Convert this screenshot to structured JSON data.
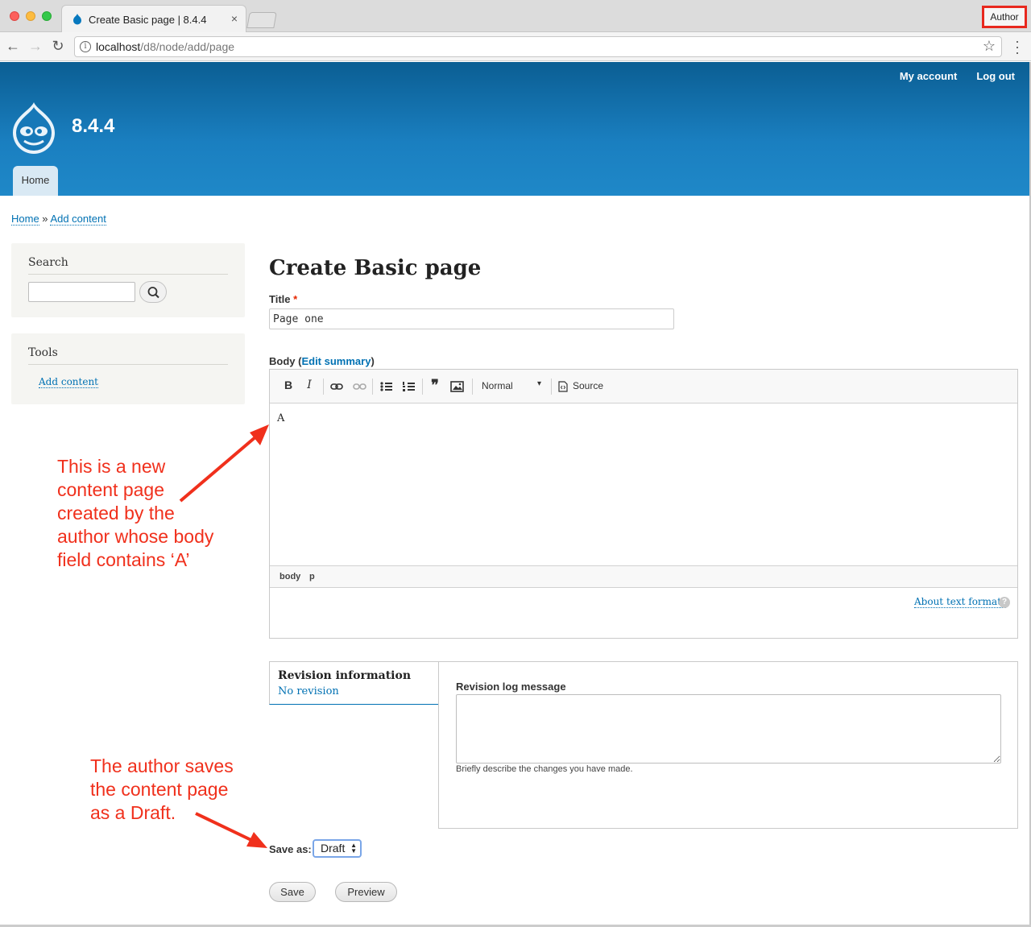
{
  "browser": {
    "tab_title": "Create Basic page | 8.4.4",
    "tab_close": "×",
    "profile_badge": "Author",
    "url_host": "localhost",
    "url_path": "/d8/node/add/page"
  },
  "header": {
    "my_account": "My account",
    "log_out": "Log out",
    "site_name": "8.4.4",
    "home_tab": "Home",
    "brand_color": "#1a7fc0"
  },
  "breadcrumb": {
    "home": "Home",
    "separator": " » ",
    "add_content": "Add content"
  },
  "sidebar": {
    "search_title": "Search",
    "search_value": "",
    "tools_title": "Tools",
    "tools_link": "Add content"
  },
  "main": {
    "page_title": "Create Basic page",
    "title_label": "Title",
    "title_required": "*",
    "title_value": "Page one",
    "body_label_prefix": "Body (",
    "edit_summary": "Edit summary",
    "body_label_suffix": ")",
    "editor": {
      "bold": "B",
      "italic": "I",
      "format": "Normal",
      "source": "Source",
      "content": "A",
      "path_body": "body",
      "path_p": "p"
    },
    "about_text_formats": "About text formats",
    "help": "?"
  },
  "revision": {
    "title": "Revision information",
    "summary": "No revision",
    "log_label": "Revision log message",
    "log_value": "",
    "description": "Briefly describe the changes you have made."
  },
  "moderation": {
    "save_as_label": "Save as:",
    "save_as_value": "Draft"
  },
  "actions": {
    "save": "Save",
    "preview": "Preview"
  },
  "annotations": {
    "note_1": [
      "This is a new",
      "content page",
      "created by the",
      "author whose body",
      "field contains ‘A’"
    ],
    "note_2": [
      "The author saves",
      "the content page",
      "as a Draft."
    ],
    "color": "#f0301c"
  }
}
